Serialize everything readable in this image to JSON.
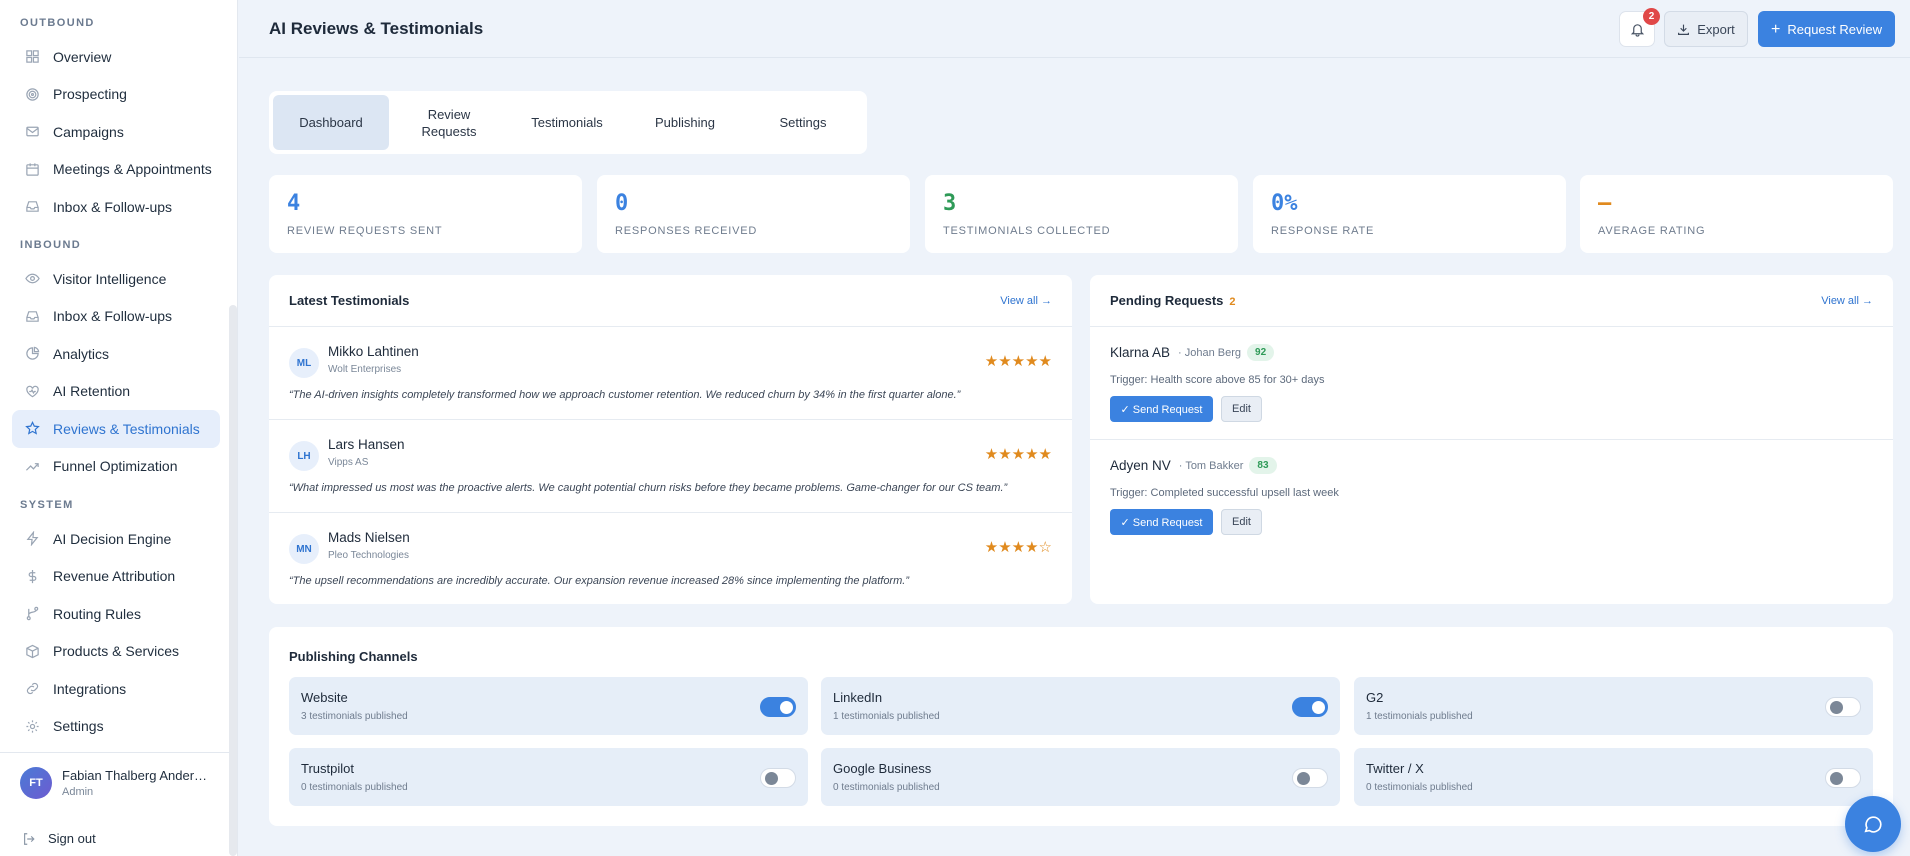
{
  "sidebar": {
    "sections": [
      {
        "title": "OUTBOUND",
        "items": [
          {
            "label": "Overview",
            "icon": "grid-icon"
          },
          {
            "label": "Prospecting",
            "icon": "target-icon"
          },
          {
            "label": "Campaigns",
            "icon": "mail-icon"
          },
          {
            "label": "Meetings & Appointments",
            "icon": "calendar-icon"
          },
          {
            "label": "Inbox & Follow-ups",
            "icon": "inbox-icon"
          }
        ]
      },
      {
        "title": "INBOUND",
        "items": [
          {
            "label": "Visitor Intelligence",
            "icon": "eye-icon"
          },
          {
            "label": "Inbox & Follow-ups",
            "icon": "inbox-icon"
          },
          {
            "label": "Analytics",
            "icon": "pie-chart-icon"
          },
          {
            "label": "AI Retention",
            "icon": "heart-icon"
          },
          {
            "label": "Reviews & Testimonials",
            "icon": "star-icon",
            "active": true
          },
          {
            "label": "Funnel Optimization",
            "icon": "trend-up-icon"
          }
        ]
      },
      {
        "title": "SYSTEM",
        "items": [
          {
            "label": "AI Decision Engine",
            "icon": "lightning-icon"
          },
          {
            "label": "Revenue Attribution",
            "icon": "dollar-icon"
          },
          {
            "label": "Routing Rules",
            "icon": "branch-icon"
          },
          {
            "label": "Products & Services",
            "icon": "box-icon"
          },
          {
            "label": "Integrations",
            "icon": "link-icon"
          },
          {
            "label": "Settings",
            "icon": "gear-icon"
          }
        ]
      }
    ],
    "user": {
      "initials": "FT",
      "name": "Fabian Thalberg Ander…",
      "role": "Admin"
    },
    "signout": "Sign out"
  },
  "header": {
    "title": "AI Reviews & Testimonials",
    "notification_count": "2",
    "export_label": "Export",
    "request_label": "Request Review"
  },
  "tabs": [
    "Dashboard",
    "Review Requests",
    "Testimonials",
    "Publishing",
    "Settings"
  ],
  "stats": [
    {
      "value": "4",
      "label": "REVIEW REQUESTS SENT",
      "color": "#3b82e0"
    },
    {
      "value": "0",
      "label": "RESPONSES RECEIVED",
      "color": "#3b82e0"
    },
    {
      "value": "3",
      "label": "TESTIMONIALS COLLECTED",
      "color": "#2e9a57"
    },
    {
      "value": "0%",
      "label": "RESPONSE RATE",
      "color": "#3b82e0"
    },
    {
      "value": "–",
      "label": "AVERAGE RATING",
      "color": "#e08a1e"
    }
  ],
  "testimonials": {
    "title": "Latest Testimonials",
    "view_all": "View all →",
    "items": [
      {
        "initials": "ML",
        "name": "Mikko Lahtinen",
        "company": "Wolt Enterprises",
        "stars": "★★★★★",
        "quote": "“The AI-driven insights completely transformed how we approach customer retention. We reduced churn by 34% in the first quarter alone.”"
      },
      {
        "initials": "LH",
        "name": "Lars Hansen",
        "company": "Vipps AS",
        "stars": "★★★★★",
        "quote": "“What impressed us most was the proactive alerts. We caught potential churn risks before they became problems. Game-changer for our CS team.”"
      },
      {
        "initials": "MN",
        "name": "Mads Nielsen",
        "company": "Pleo Technologies",
        "stars": "★★★★☆",
        "quote": "“The upsell recommendations are incredibly accurate. Our expansion revenue increased 28% since implementing the platform.”"
      }
    ]
  },
  "pending": {
    "title": "Pending Requests",
    "count": "2",
    "view_all": "View all →",
    "items": [
      {
        "company": "Klarna AB",
        "contact": "· Johan Berg",
        "score": "92",
        "trigger": "Trigger: Health score above 85 for 30+ days",
        "send": "✓ Send Request",
        "edit": "Edit"
      },
      {
        "company": "Adyen NV",
        "contact": "· Tom Bakker",
        "score": "83",
        "trigger": "Trigger: Completed successful upsell last week",
        "send": "✓ Send Request",
        "edit": "Edit"
      }
    ]
  },
  "channels": {
    "title": "Publishing Channels",
    "items": [
      {
        "name": "Website",
        "sub": "3 testimonials published",
        "enabled": true
      },
      {
        "name": "LinkedIn",
        "sub": "1 testimonials published",
        "enabled": true
      },
      {
        "name": "G2",
        "sub": "1 testimonials published",
        "enabled": false
      },
      {
        "name": "Trustpilot",
        "sub": "0 testimonials published",
        "enabled": false
      },
      {
        "name": "Google Business",
        "sub": "0 testimonials published",
        "enabled": false
      },
      {
        "name": "Twitter / X",
        "sub": "0 testimonials published",
        "enabled": false
      }
    ]
  }
}
